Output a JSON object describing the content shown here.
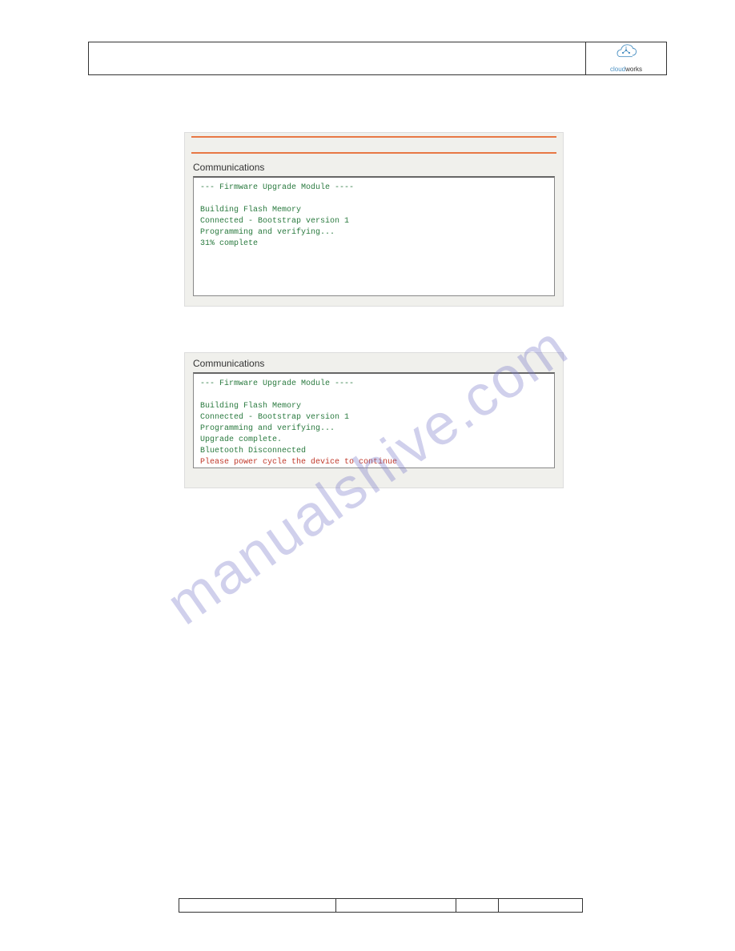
{
  "watermark": "manualshive.com",
  "logo": {
    "text_cloud": "cloud",
    "text_works": "works"
  },
  "screenshot1": {
    "label": "Communications",
    "lines": [
      "--- Firmware Upgrade Module ----",
      "",
      "Building Flash Memory",
      "Connected - Bootstrap version 1",
      "Programming and verifying...",
      "31% complete"
    ]
  },
  "screenshot2": {
    "label": "Communications",
    "lines_green": [
      "--- Firmware Upgrade Module ----",
      "",
      "Building Flash Memory",
      "Connected - Bootstrap version 1",
      "Programming and verifying...",
      "Upgrade complete.",
      "Bluetooth Disconnected"
    ],
    "line_red": "Please power cycle the device to continue"
  }
}
